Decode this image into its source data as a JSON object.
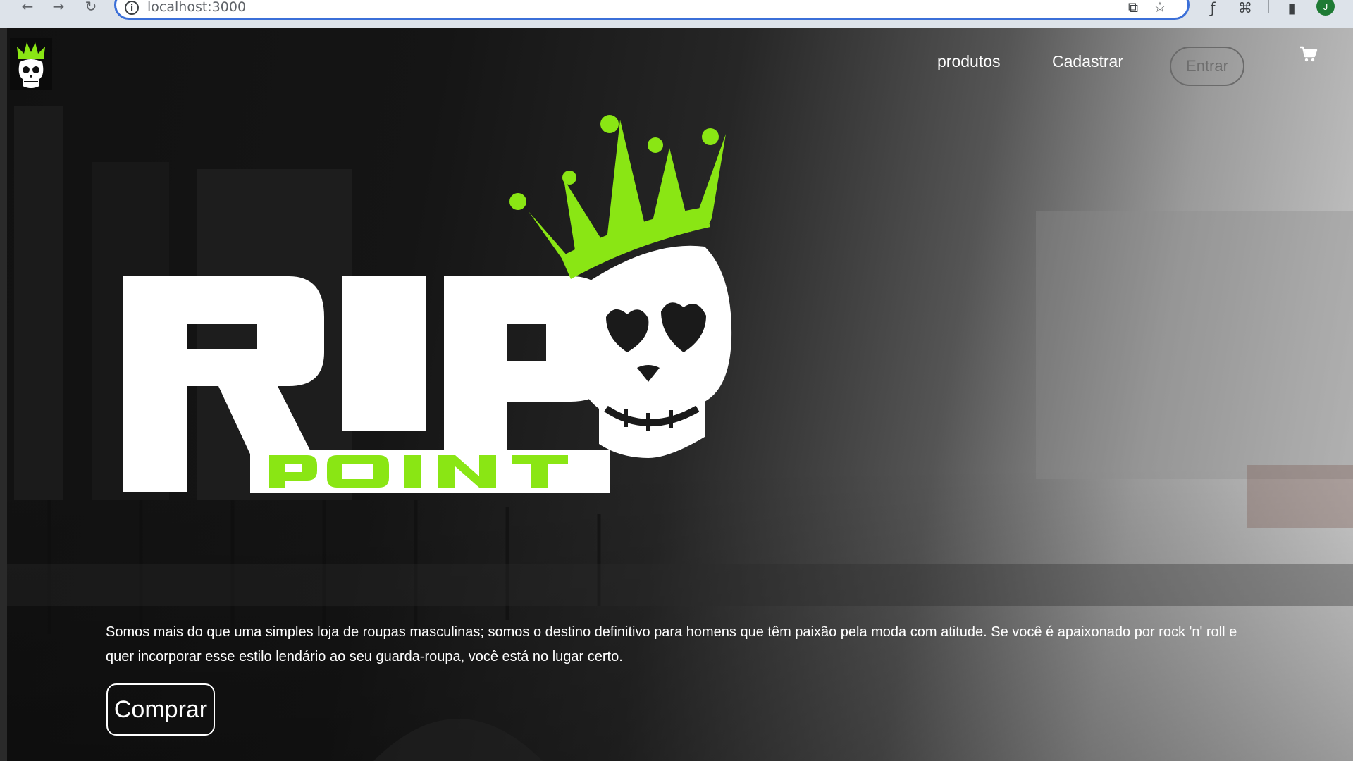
{
  "browser": {
    "url": "localhost:3000",
    "profile_initial": "J",
    "icons": [
      "back-icon",
      "forward-icon",
      "reload-icon",
      "info-icon",
      "open-in-app-icon",
      "bookmark-star-icon",
      "formula-extension-icon",
      "extensions-puzzle-icon",
      "side-panel-icon",
      "profile-avatar"
    ]
  },
  "nav": {
    "links": [
      {
        "label": "produtos"
      },
      {
        "label": "Cadastrar"
      }
    ],
    "login_label": "Entrar",
    "icons": [
      "brand-skull-logo-icon",
      "cart-icon"
    ]
  },
  "hero": {
    "brand_top": "RIP",
    "brand_bottom": "POINT",
    "tagline": "Somos mais do que uma simples loja de roupas masculinas; somos o destino definitivo para homens que têm paixão pela moda com atitude. Se você é apaixonado por rock 'n' roll e quer incorporar esse estilo lendário ao seu guarda-roupa, você está no lugar certo.",
    "cta_label": "Comprar"
  },
  "colors": {
    "accent_green": "#8ae614",
    "text_white": "#ffffff",
    "omnibox_border": "#3b6fd8"
  }
}
